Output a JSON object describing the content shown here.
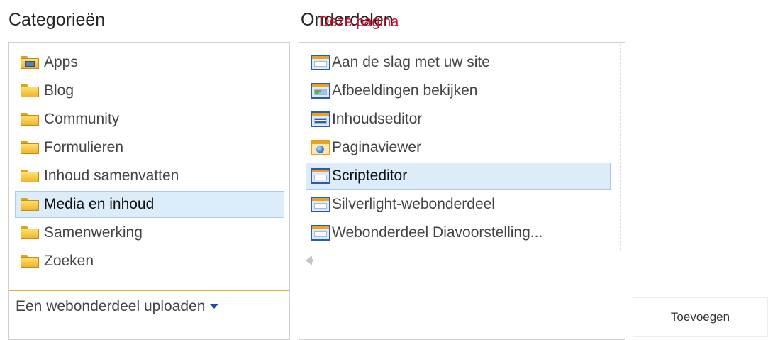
{
  "categories": {
    "heading": "Categorieën",
    "items": [
      {
        "label": "Apps",
        "icon": "apps-folder-icon",
        "selected": false
      },
      {
        "label": "Blog",
        "icon": "folder-icon",
        "selected": false
      },
      {
        "label": "Community",
        "icon": "folder-icon",
        "selected": false
      },
      {
        "label": "Formulieren",
        "icon": "folder-icon",
        "selected": false
      },
      {
        "label": "Inhoud samenvatten",
        "icon": "folder-icon",
        "selected": false
      },
      {
        "label": "Media en inhoud",
        "icon": "folder-icon",
        "selected": true
      },
      {
        "label": "Samenwerking",
        "icon": "folder-icon",
        "selected": false
      },
      {
        "label": "Zoeken",
        "icon": "folder-icon",
        "selected": false
      }
    ],
    "upload_label": "Een webonderdeel uploaden"
  },
  "parts": {
    "heading": "Onderdelen",
    "overlay_text": "Deze pagina",
    "items": [
      {
        "label": "Aan de slag met uw site",
        "icon": "webpart-icon",
        "selected": false
      },
      {
        "label": "Afbeeldingen bekijken",
        "icon": "image-viewer-icon",
        "selected": false
      },
      {
        "label": "Inhoudseditor",
        "icon": "content-editor-icon",
        "selected": false
      },
      {
        "label": "Paginaviewer",
        "icon": "page-viewer-icon",
        "selected": false
      },
      {
        "label": "Scripteditor",
        "icon": "webpart-icon",
        "selected": true
      },
      {
        "label": "Silverlight-webonderdeel",
        "icon": "webpart-icon",
        "selected": false
      },
      {
        "label": "Webonderdeel Diavoorstelling...",
        "icon": "webpart-icon",
        "selected": false
      }
    ]
  },
  "actions": {
    "add_label": "Toevoegen"
  },
  "colors": {
    "selection_bg": "#ddecf9",
    "selection_border": "#a9cbee",
    "overlay_red": "#c8102e",
    "upload_separator": "#f0a63a"
  }
}
